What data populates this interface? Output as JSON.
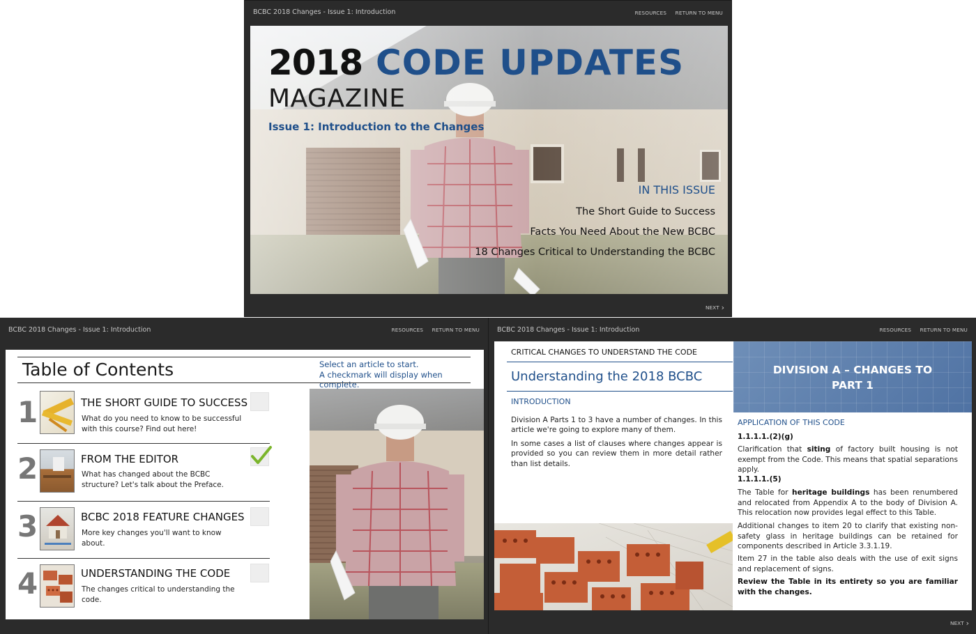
{
  "windows": {
    "cover": {
      "title": "BCBC 2018 Changes - Issue 1: Introduction",
      "links": {
        "resources": "RESOURCES",
        "return_to_menu": "RETURN TO MENU"
      },
      "next": "NEXT"
    },
    "toc": {
      "title": "BCBC 2018 Changes - Issue 1: Introduction",
      "links": {
        "resources": "RESOURCES",
        "return_to_menu": "RETURN TO MENU"
      }
    },
    "article": {
      "title": "BCBC 2018 Changes - Issue 1: Introduction",
      "links": {
        "resources": "RESOURCES",
        "return_to_menu": "RETURN TO MENU"
      },
      "next": "NEXT"
    }
  },
  "cover": {
    "year": "2018",
    "headline": "CODE UPDATES",
    "magazine": "MAGAZINE",
    "issue": "Issue 1: Introduction to the Changes",
    "in_this_issue": "IN THIS ISSUE",
    "items": [
      "The Short Guide to Success",
      "Facts You Need About the New BCBC",
      "18 Changes Critical to Understanding the BCBC"
    ]
  },
  "toc": {
    "heading": "Table of Contents",
    "hint_line1": "Select an article to start.",
    "hint_line2": "A checkmark will display when complete.",
    "articles": [
      {
        "number": "1",
        "title": "THE SHORT GUIDE TO SUCCESS",
        "desc": "What do you need to know to be successful with this course? Find out here!",
        "complete": false,
        "thumb": "measuring-tape-thumbnail"
      },
      {
        "number": "2",
        "title": "FROM THE EDITOR",
        "desc": "What has changed about the BCBC structure? Let's talk about the Preface.",
        "complete": true,
        "thumb": "desk-thumbnail"
      },
      {
        "number": "3",
        "title": "BCBC 2018 FEATURE CHANGES",
        "desc": "More key changes you'll want to know about.",
        "complete": false,
        "thumb": "house-model-thumbnail"
      },
      {
        "number": "4",
        "title": "UNDERSTANDING THE CODE",
        "desc": "The changes critical to understanding the code.",
        "complete": false,
        "thumb": "bricks-thumbnail"
      }
    ]
  },
  "article": {
    "kicker": "CRITICAL CHANGES TO UNDERSTAND THE CODE",
    "title": "Understanding the 2018 BCBC",
    "section": "INTRODUCTION",
    "para1": "Division A Parts 1 to 3 have a number of changes. In this article we're going to explore many of them.",
    "para2": "In some cases a list of clauses where changes appear is provided so you can review them in more detail rather than list details.",
    "banner_line1": "DIVISION A – CHANGES TO",
    "banner_line2": "PART 1",
    "application": "APPLICATION OF THIS CODE",
    "clause1": "1.1.1.1.(2)(g)",
    "clause1_a": "Clarification that ",
    "clause1_b": "siting",
    "clause1_c": " of factory built housing is not exempt from the Code. This means that spatial separations apply.",
    "clause2": "1.1.1.1.(5)",
    "clause2_a": "The Table for ",
    "clause2_b": "heritage buildings",
    "clause2_c": " has been renumbered and relocated from Appendix A to the body of Division A. This relocation now provides legal effect to this Table.",
    "clause2_p2": "Additional changes to item 20 to clarify that existing non-safety glass in heritage buildings can be retained for components described in Article 3.3.1.19.",
    "clause2_p3": "Item 27 in the table also deals with the use of exit signs and replacement of signs.",
    "clause2_p4": "Review the Table in its entirety so you are familiar with the changes."
  },
  "colors": {
    "accent": "#1f4f8a",
    "chrome": "#2b2b2b"
  }
}
